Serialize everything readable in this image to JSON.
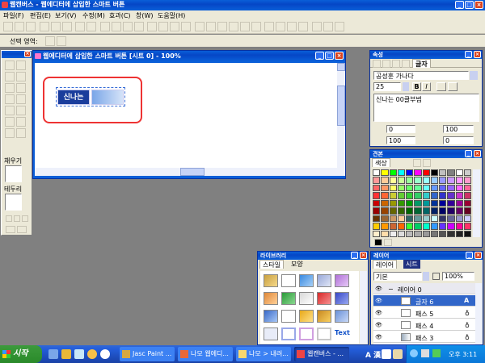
{
  "app": {
    "title": "웹캔버스 - 웹에디터에 삽입한 스마트 버튼",
    "menu": [
      "파일(F)",
      "편집(E)",
      "보기(V)",
      "수정(M)",
      "효과(C)",
      "창(W)",
      "도움말(H)"
    ],
    "select_area_label": "선택 영역:"
  },
  "doc_window": {
    "title": "웹에디터에 삽입한 스마트 버튼 [시트 0] - 100%",
    "button_text": "신나는"
  },
  "tools": {
    "fill_label": "채우기",
    "stroke_label": "테두리"
  },
  "props": {
    "title": "속성",
    "tab_text": "글자",
    "font_name": "공성훈 가나다",
    "font_size": "25",
    "bold": "B",
    "italic": "I",
    "text_value": "신나는 00클부범",
    "spacing_val": "0",
    "scale_val": "100",
    "line_val": "100",
    "baseline_val": "0"
  },
  "palette": {
    "title": "견본",
    "tab": "색상",
    "colors": [
      "#ffffff",
      "#ffff00",
      "#00ff00",
      "#00ffff",
      "#0000ff",
      "#ff00ff",
      "#ff0000",
      "#000000",
      "#c0c0c0",
      "#808080",
      "#ffffff",
      "#cccccc",
      "#ff9999",
      "#ffcc99",
      "#ffff99",
      "#ccff99",
      "#99ff99",
      "#99ffcc",
      "#99ffff",
      "#99ccff",
      "#9999ff",
      "#cc99ff",
      "#ff99ff",
      "#ff99cc",
      "#ff6666",
      "#ff9966",
      "#ffff66",
      "#99ff66",
      "#66ff66",
      "#66ff99",
      "#66ffff",
      "#6699ff",
      "#6666ff",
      "#9966ff",
      "#ff66ff",
      "#ff6699",
      "#ff3333",
      "#ff6633",
      "#cccc33",
      "#66cc33",
      "#33cc33",
      "#33cc66",
      "#33cccc",
      "#3366cc",
      "#3333cc",
      "#6633cc",
      "#cc33cc",
      "#cc3366",
      "#cc0000",
      "#cc6600",
      "#999900",
      "#339900",
      "#009900",
      "#009966",
      "#009999",
      "#003399",
      "#000099",
      "#330099",
      "#990099",
      "#990033",
      "#990000",
      "#994400",
      "#666600",
      "#336600",
      "#006600",
      "#006633",
      "#006666",
      "#002266",
      "#000066",
      "#220066",
      "#660066",
      "#660022",
      "#663300",
      "#996633",
      "#cc9966",
      "#ffcc99",
      "#336666",
      "#669999",
      "#99cccc",
      "#ccffff",
      "#333366",
      "#666699",
      "#9999cc",
      "#ccccff",
      "#ffcc00",
      "#ff9900",
      "#cc6633",
      "#ff6600",
      "#33ff33",
      "#00cc66",
      "#00ffcc",
      "#3399ff",
      "#6633ff",
      "#cc00ff",
      "#ff0099",
      "#ff3366",
      "#ffeecc",
      "#ffddaa",
      "#eeeeee",
      "#dddddd",
      "#bbbbbb",
      "#aaaaaa",
      "#999999",
      "#777777",
      "#555555",
      "#333333",
      "#222222",
      "#111111"
    ]
  },
  "library": {
    "title": "라이브러리",
    "tab_style": "스타일",
    "tab_shape": "모양",
    "text_tile": "Text"
  },
  "layers": {
    "title": "레이어",
    "tab_layer": "레이어",
    "tab_sheet": "시트",
    "blend": "기본",
    "opacity": "100%",
    "items": [
      {
        "name": "레이어 0",
        "group": true
      },
      {
        "name": "글자 6",
        "selected": true
      },
      {
        "name": "패스 5"
      },
      {
        "name": "패스 4"
      },
      {
        "name": "패스 3"
      }
    ]
  },
  "taskbar": {
    "start": "시작",
    "tasks": [
      "Jasc Paint ...",
      "나모 웹에디...",
      "나모 > 내려...",
      "웹캔버스 - ..."
    ],
    "ime": "A 漢",
    "clock": "오후 3:11"
  }
}
